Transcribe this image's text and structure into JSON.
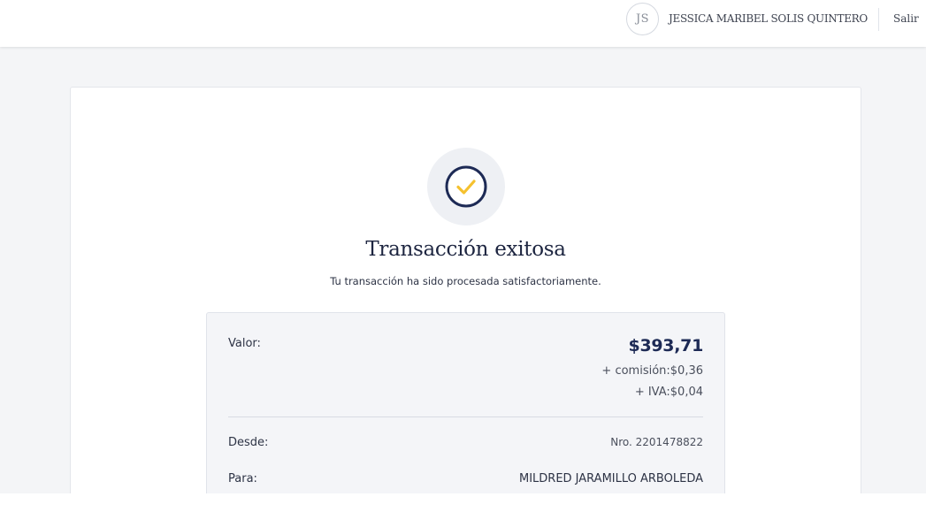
{
  "header": {
    "avatar_initials": "JS",
    "user_name": "JESSICA MARIBEL SOLIS QUINTERO",
    "logout_label": "Salir"
  },
  "result": {
    "icon": "check-circle-icon",
    "title": "Transacción exitosa",
    "subtitle": "Tu transacción ha sido procesada satisfactoriamente."
  },
  "details": {
    "value_label": "Valor:",
    "amount": "$393,71",
    "commission": "+ comisión:$0,36",
    "iva": "+ IVA:$0,04",
    "from_label": "Desde:",
    "from_value": "Nro. 2201478822",
    "to_label": "Para:",
    "to_value": "MILDRED JARAMILLO ARBOLEDA"
  },
  "colors": {
    "brand_navy": "#1d2a55",
    "check_yellow": "#f5c12e",
    "page_background": "#f4f5f7"
  }
}
